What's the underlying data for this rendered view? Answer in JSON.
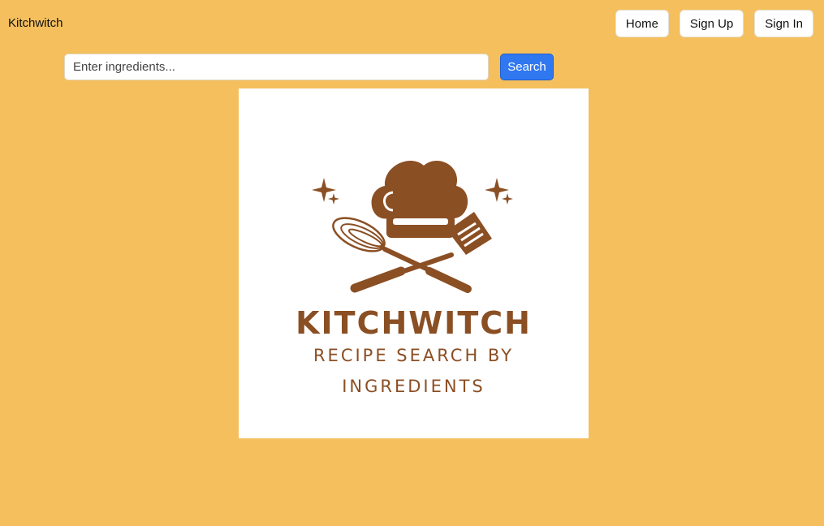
{
  "header": {
    "brand": "Kitchwitch",
    "nav": [
      {
        "label": "Home"
      },
      {
        "label": "Sign Up"
      },
      {
        "label": "Sign In"
      }
    ]
  },
  "search": {
    "placeholder": "Enter ingredients...",
    "value": "",
    "button_label": "Search"
  },
  "logo": {
    "title": "KITCHWITCH",
    "subtitle_line1": "RECIPE SEARCH BY",
    "subtitle_line2": "INGREDIENTS",
    "color": "#8b4f24"
  },
  "colors": {
    "background": "#f4bf5c",
    "accent": "#2f78f0",
    "logo_brown": "#8b4f24"
  }
}
